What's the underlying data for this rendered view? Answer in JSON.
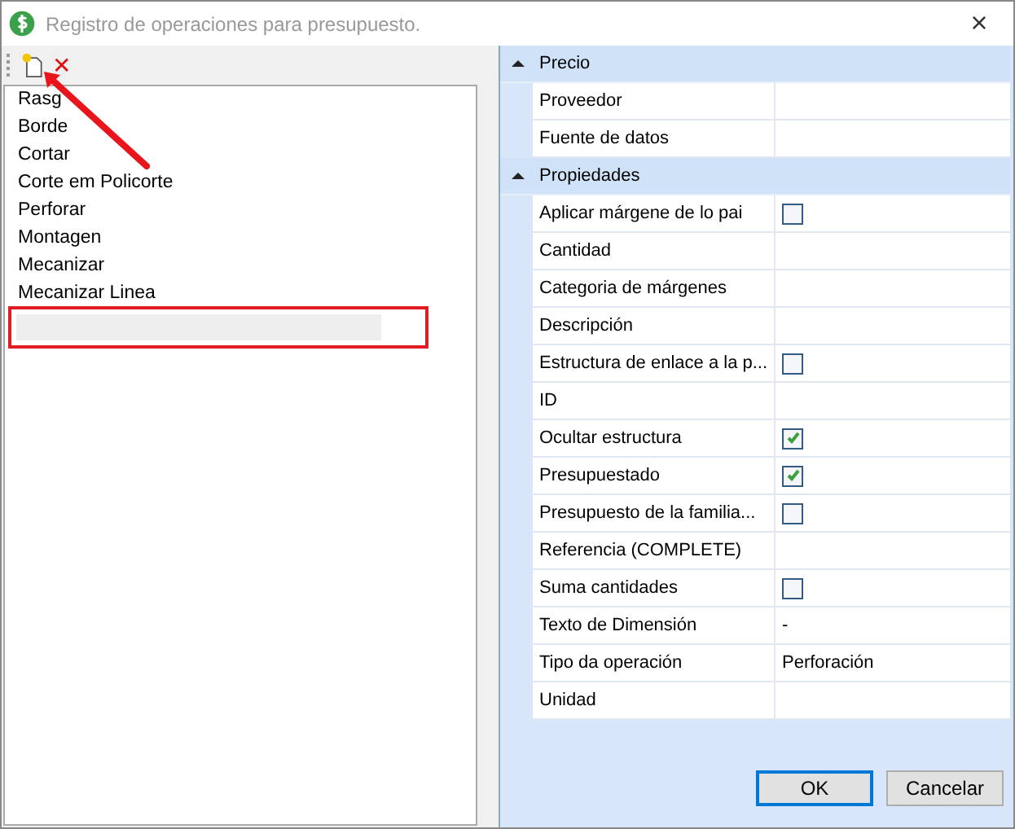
{
  "window": {
    "title": "Registro de operaciones para presupuesto.",
    "close": "×"
  },
  "toolbar": {
    "delete": "✕"
  },
  "list": {
    "items": [
      {
        "label": "Rasg"
      },
      {
        "label": "Borde"
      },
      {
        "label": "Cortar"
      },
      {
        "label": "Corte em Policorte"
      },
      {
        "label": "Perforar"
      },
      {
        "label": "Montagen"
      },
      {
        "label": "Mecanizar"
      },
      {
        "label": "Mecanizar Linea"
      },
      {
        "kind": "blank"
      }
    ]
  },
  "annotations": {
    "arrow": true,
    "highlight_box": true
  },
  "properties": [
    {
      "category": "Precio",
      "expanded": true,
      "rows": [
        {
          "name": "Proveedor",
          "kind": "text"
        },
        {
          "name": "Fuente de datos",
          "kind": "text"
        }
      ]
    },
    {
      "category": "Propiedades",
      "expanded": true,
      "rows": [
        {
          "name": "Aplicar márgene de lo pai",
          "kind": "check",
          "checked": false
        },
        {
          "name": "Cantidad",
          "kind": "text"
        },
        {
          "name": "Categoria de márgenes",
          "kind": "text"
        },
        {
          "name": "Descripción",
          "kind": "text"
        },
        {
          "name": "Estructura de enlace a la p...",
          "kind": "check",
          "checked": false
        },
        {
          "name": "ID",
          "kind": "text"
        },
        {
          "name": "Ocultar estructura",
          "kind": "check",
          "checked": true
        },
        {
          "name": "Presupuestado",
          "kind": "check",
          "checked": true
        },
        {
          "name": "Presupuesto de la familia...",
          "kind": "check",
          "checked": false
        },
        {
          "name": "Referencia (COMPLETE)",
          "kind": "text"
        },
        {
          "name": "Suma cantidades",
          "kind": "check",
          "checked": false
        },
        {
          "name": "Texto de Dimensión",
          "kind": "text",
          "value": "-"
        },
        {
          "name": "Tipo da operación",
          "kind": "text",
          "value": "Perforación"
        },
        {
          "name": "Unidad",
          "kind": "text"
        }
      ]
    }
  ],
  "buttons": [
    {
      "label": "OK",
      "default": true
    },
    {
      "label": "Cancelar",
      "default": false
    }
  ]
}
